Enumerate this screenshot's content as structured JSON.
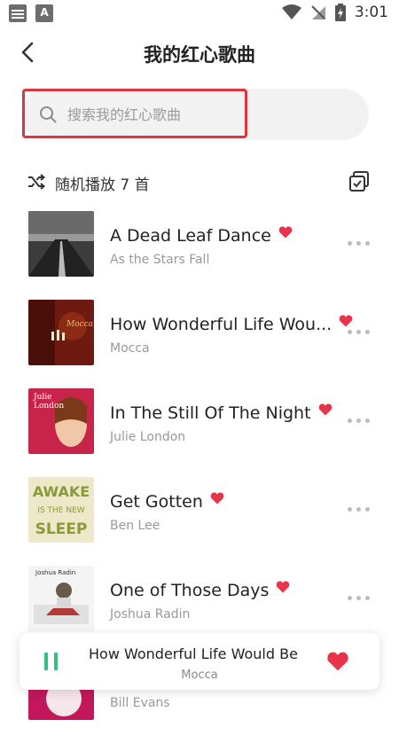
{
  "status_bar": {
    "time": "3:01"
  },
  "header": {
    "title": "我的红心歌曲"
  },
  "search": {
    "placeholder": "搜索我的红心歌曲"
  },
  "shuffle": {
    "label": "随机播放 7 首"
  },
  "songs": [
    {
      "title": "A Dead Leaf Dance",
      "artist": "As the Stars Fall",
      "liked": true
    },
    {
      "title": "How Wonderful Life Wou...",
      "artist": "Mocca",
      "liked": true
    },
    {
      "title": "In The Still Of The Night",
      "artist": "Julie London",
      "liked": true
    },
    {
      "title": "Get Gotten",
      "artist": "Ben Lee",
      "liked": true
    },
    {
      "title": "One of Those Days",
      "artist": "Joshua Radin",
      "liked": true
    },
    {
      "title": "",
      "artist": "Bill Evans",
      "liked": false
    }
  ],
  "cover_texts": {
    "mocca": "Mocca",
    "julie_line1": "Julie",
    "julie_line2": "London",
    "awake": "AWAKE",
    "is_the_new": "IS THE NEW",
    "sleep": "SLEEP",
    "joshua": "Joshua Radin"
  },
  "now_playing": {
    "title": "How Wonderful Life Would Be",
    "artist": "Mocca",
    "liked": true
  },
  "colors": {
    "accent_red": "#e8334a",
    "play_green": "#31c27c",
    "highlight_red": "#d9363e"
  }
}
